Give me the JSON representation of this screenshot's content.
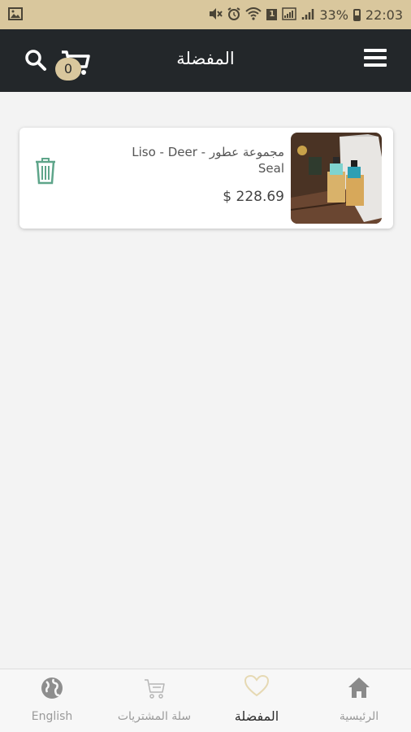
{
  "status_bar": {
    "battery_percent": "33%",
    "time": "22:03",
    "sim_number": "1"
  },
  "header": {
    "title": "المفضلة",
    "cart_count": "0"
  },
  "favorites": [
    {
      "name": "مجموعة عطور Liso - Deer - Seal",
      "price": "$ 228.69"
    }
  ],
  "bottom_nav": {
    "items": [
      {
        "label": "English",
        "icon": "globe-icon"
      },
      {
        "label": "سلة المشتريات",
        "icon": "cart-icon"
      },
      {
        "label": "المفضلة",
        "icon": "heart-icon"
      },
      {
        "label": "الرئيسية",
        "icon": "home-icon"
      }
    ],
    "active": "المفضلة"
  },
  "colors": {
    "status_bar": "#d9c79d",
    "header": "#23272a",
    "accent": "#d9c79d",
    "delete_icon": "#5ea58a"
  }
}
